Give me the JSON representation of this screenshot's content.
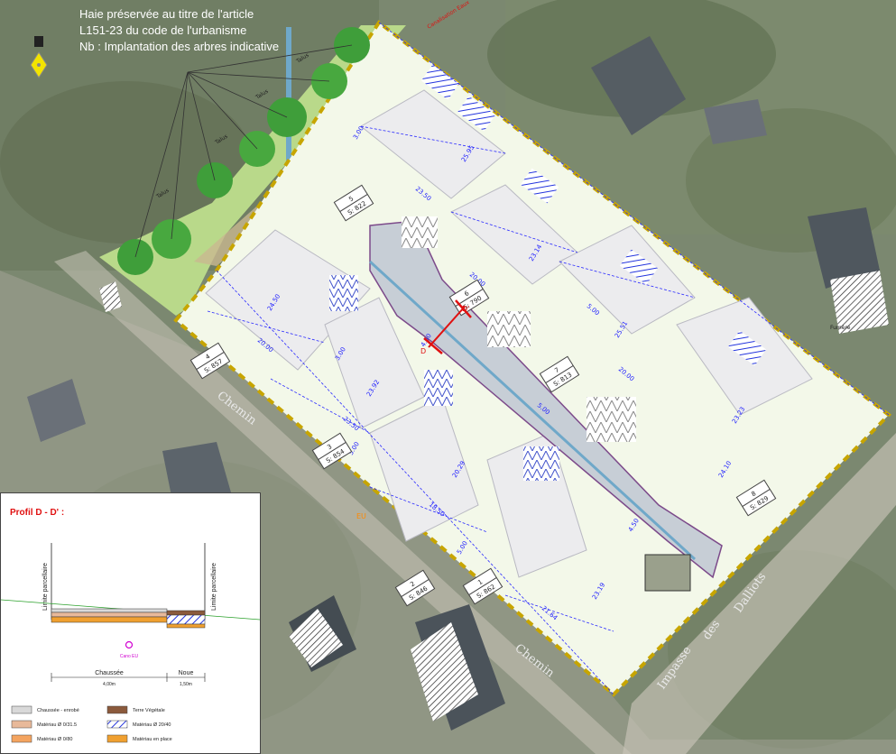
{
  "map": {
    "notes": [
      "Haie préservée au titre de l'article",
      "L151-23 du code de l'urbanisme",
      "Nb : Implantation des arbres indicative"
    ],
    "roads": {
      "chemin_1": "Chemin",
      "chemin_2": "Chemin",
      "impasse": "Impasse",
      "des": "des",
      "dalliots": "Dalliots"
    },
    "hedge_labels": [
      "Talus",
      "Talus",
      "Talus",
      "Talus"
    ],
    "canalisation_label": "Canalisation Eaux",
    "lots": [
      {
        "num": "1",
        "area": "S: 862"
      },
      {
        "num": "2",
        "area": "S: 846"
      },
      {
        "num": "3",
        "area": "S: 854"
      },
      {
        "num": "4",
        "area": "S: 857"
      },
      {
        "num": "5",
        "area": "S: 822"
      },
      {
        "num": "6",
        "area": "S: 790"
      },
      {
        "num": "7",
        "area": "S: 813"
      },
      {
        "num": "8",
        "area": "S: 829"
      }
    ],
    "dimensions": [
      "25.95",
      "23.50",
      "20.00",
      "23.14",
      "25.51",
      "20.00",
      "23.23",
      "24.10",
      "24.50",
      "20.00",
      "23.50",
      "23.92",
      "20.29",
      "18.50",
      "21.64",
      "23.19",
      "5.00",
      "5.00",
      "3.00",
      "3.00",
      "5.00",
      "4.50",
      "4.50",
      "5.00"
    ],
    "section_markers": {
      "d": "D",
      "d_prime": "D'"
    },
    "ep_label": "EU",
    "house_label": "Fumère"
  },
  "profile": {
    "title": "Profil   D - D' :",
    "left_label": "Limite parcellaire",
    "right_label": "Limite parcellaire",
    "chaussee_label": "Chaussée",
    "chaussee_width": "4,00m",
    "noue_label": "Noue",
    "noue_width": "1,50m",
    "regard_label": "Cano EU",
    "legend": [
      {
        "label": "Chaussée - enrobé",
        "color": "#d9d9d9"
      },
      {
        "label": "Terre Végétale",
        "color": "#8b5a3c"
      },
      {
        "label": "Matériau Ø 0/31.5",
        "color": "#e8b99a"
      },
      {
        "label": "Matériau Ø 20/40",
        "color": "#1a1aff"
      },
      {
        "label": "Matériau Ø 0/80",
        "color": "#f4a460"
      },
      {
        "label": "Matériau en place",
        "color": "#f0a030"
      }
    ]
  }
}
